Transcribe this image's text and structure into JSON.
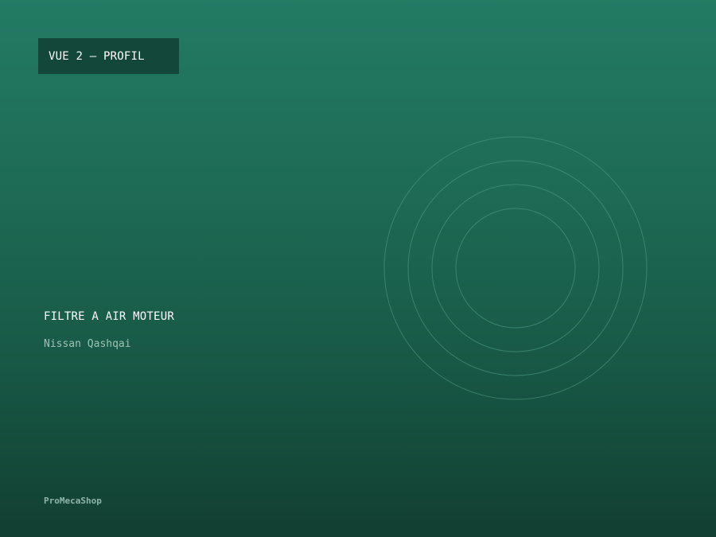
{
  "badge": {
    "label": "VUE 2 — PROFIL"
  },
  "product": {
    "title": "FILTRE A AIR MOTEUR",
    "vehicle": "Nissan Qashqai"
  },
  "footer": {
    "brand": "ProMecaShop"
  },
  "colors": {
    "background_top": "#237b64",
    "background_bottom": "#123f32",
    "badge_background": "#13473a",
    "ring_stroke": "#4f9b84"
  },
  "illustration": {
    "icon": "concentric-rings-icon",
    "ring_count": 4
  }
}
